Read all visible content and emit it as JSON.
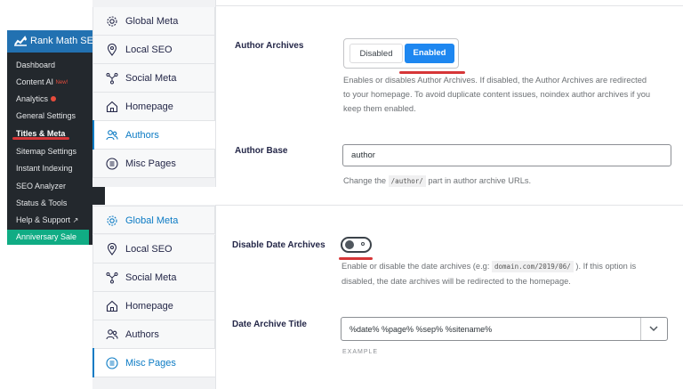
{
  "wp_menu": {
    "title": "Rank Math SEO",
    "items": [
      {
        "label": "Dashboard"
      },
      {
        "label": "Content AI",
        "badge": "New!"
      },
      {
        "label": "Analytics"
      },
      {
        "label": "General Settings"
      },
      {
        "label": "Titles & Meta"
      },
      {
        "label": "Sitemap Settings"
      },
      {
        "label": "Instant Indexing"
      },
      {
        "label": "SEO Analyzer"
      },
      {
        "label": "Status & Tools"
      },
      {
        "label": "Help & Support"
      }
    ],
    "anniversary": "Anniversary Sale"
  },
  "top_panel": {
    "tabs": [
      "Global Meta",
      "Local SEO",
      "Social Meta",
      "Homepage",
      "Authors",
      "Misc Pages"
    ],
    "active_tab": "Authors",
    "author_archives": {
      "label": "Author Archives",
      "options": [
        "Disabled",
        "Enabled"
      ],
      "selected": "Enabled",
      "desc_lines": [
        "Enables or disables Author Archives. If disabled, the Author Archives are redirected",
        "to your homepage. To avoid duplicate content issues, noindex author archives if you",
        "keep them enabled."
      ]
    },
    "author_base": {
      "label": "Author Base",
      "value": "author",
      "desc_before": "Change the",
      "desc_code": "/author/",
      "desc_after": "part in author archive URLs."
    }
  },
  "bottom_panel": {
    "tabs": [
      "Global Meta",
      "Local SEO",
      "Social Meta",
      "Homepage",
      "Authors",
      "Misc Pages"
    ],
    "active_tab": "Misc Pages",
    "date_archives": {
      "label": "Disable Date Archives",
      "toggle_state": "off",
      "desc_line1_before": "Enable or disable the date archives (e.g:",
      "desc_code": "domain.com/2019/06/",
      "desc_line1_after": "). If this option is",
      "desc_line2": "disabled, the date archives will be redirected to the homepage."
    },
    "date_archive_title": {
      "label": "Date Archive Title",
      "value": "%date% %page% %sep% %sitename%",
      "example_label": "EXAMPLE"
    }
  },
  "colors": {
    "accent": "#0c7bc4",
    "button": "#1e87f0",
    "highlight": "#d63638",
    "sidebar": "#23282d",
    "wp_blue": "#2271b1",
    "anniversary": "#10ac84"
  }
}
